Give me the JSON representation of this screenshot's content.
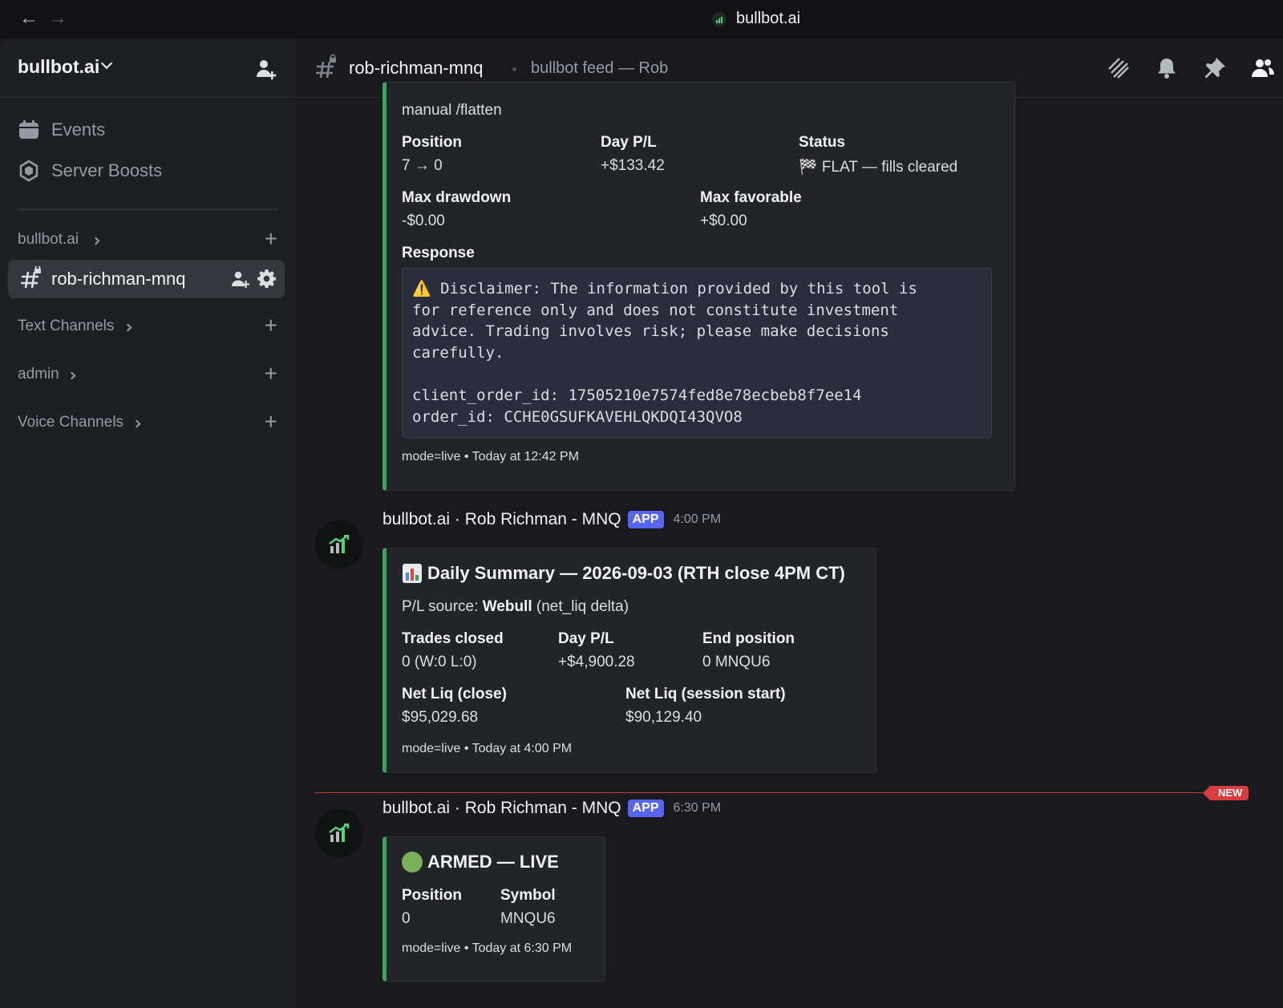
{
  "topbar": {
    "back": "←",
    "forward": "→",
    "title": "bullbot.ai"
  },
  "sidebar": {
    "server_name": "bullbot.ai",
    "items": [
      {
        "label": "Events",
        "icon": "calendar-icon"
      },
      {
        "label": "Server Boosts",
        "icon": "boost-icon"
      }
    ],
    "categories": [
      {
        "label": "bullbot.ai"
      },
      {
        "label": "Text Channels"
      },
      {
        "label": "admin"
      },
      {
        "label": "Voice Channels"
      }
    ],
    "active_channel": "rob-richman-mnq"
  },
  "header": {
    "channel": "rob-richman-mnq",
    "topic": "bullbot feed — Rob"
  },
  "messages": {
    "flatten": {
      "top_text": "manual /flatten",
      "fields": [
        {
          "title": "Position",
          "value": "7 → 0"
        },
        {
          "title": "Day P/L",
          "value": "+$133.42"
        },
        {
          "title": "Status",
          "value": "🏁 FLAT — fills cleared"
        },
        {
          "title": "Max drawdown",
          "value": "-$0.00"
        },
        {
          "title": "Max favorable",
          "value": "+$0.00"
        }
      ],
      "response_title": "Response",
      "code": "⚠️ Disclaimer: The information provided by this tool is\nfor reference only and does not constitute investment\nadvice. Trading involves risk; please make decisions\ncarefully.\n\nclient_order_id: 17505210e7574fed8e78ecbeb8f7ee14\norder_id: CCHE0GSUFKAVEHLQKDQI43QVO8",
      "footer": "mode=live • Today at 12:42 PM"
    },
    "summary": {
      "author": "bullbot.ai · Rob Richman - MNQ",
      "tag": "APP",
      "time": "4:00 PM",
      "title": "Daily Summary — 2026-09-03 (RTH close 4PM CT)",
      "source_prefix": "P/L source: ",
      "source_bold": "Webull",
      "source_suffix": " (net_liq delta)",
      "fields": [
        {
          "title": "Trades closed",
          "value": "0 (W:0 L:0)"
        },
        {
          "title": "Day P/L",
          "value": "+$4,900.28"
        },
        {
          "title": "End position",
          "value": "0 MNQU6"
        },
        {
          "title": "Net Liq (close)",
          "value": "$95,029.68"
        },
        {
          "title": "Net Liq (session start)",
          "value": "$90,129.40"
        }
      ],
      "footer": "mode=live • Today at 4:00 PM"
    },
    "new_badge": "NEW",
    "armed": {
      "author": "bullbot.ai · Rob Richman - MNQ",
      "tag": "APP",
      "time": "6:30 PM",
      "title": "ARMED — LIVE",
      "fields": [
        {
          "title": "Position",
          "value": "0"
        },
        {
          "title": "Symbol",
          "value": "MNQU6"
        }
      ],
      "footer": "mode=live • Today at 6:30 PM"
    }
  },
  "colors": {
    "accent_green": "#3ba55d",
    "app_tag": "#5865f2",
    "new_red": "#d83c3e"
  }
}
